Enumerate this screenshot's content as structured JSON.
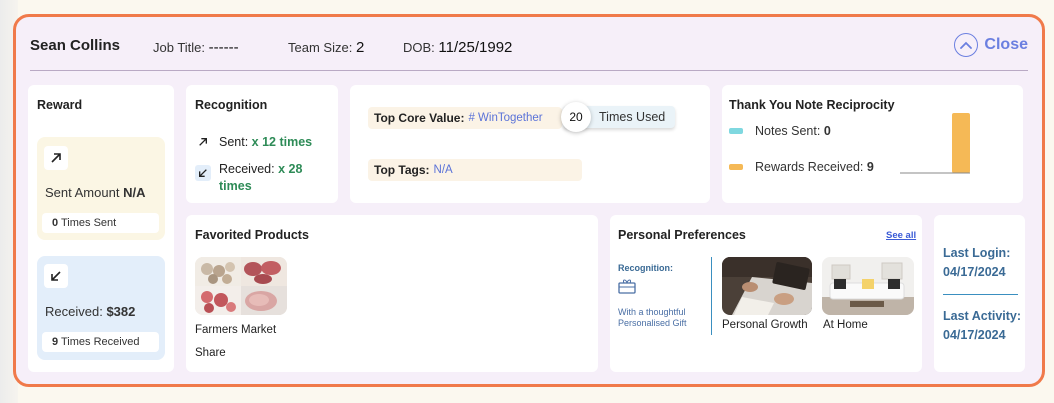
{
  "header": {
    "name": "Sean Collins",
    "job_title_label": "Job Title:",
    "job_title_value": "------",
    "team_size_label": "Team Size:",
    "team_size_value": "2",
    "dob_label": "DOB:",
    "dob_value": "11/25/1992",
    "close_label": "Close"
  },
  "reward": {
    "title": "Reward",
    "sent_label": "Sent Amount",
    "sent_value": "N/A",
    "times_sent_count": "0",
    "times_sent_label": "Times Sent",
    "received_label": "Received:",
    "received_value": "$382",
    "times_received_count": "9",
    "times_received_label": "Times Received"
  },
  "recognition": {
    "title": "Recognition",
    "sent_label": "Sent:",
    "sent_value": "x 12 times",
    "received_label": "Received:",
    "received_value_line1": "x 28",
    "received_value_line2": "times"
  },
  "core_value": {
    "label": "Top Core Value:",
    "value": "# WinTogether",
    "count": "20",
    "times_used_label": "Times Used",
    "top_tags_label": "Top Tags:",
    "top_tags_value": "N/A"
  },
  "reciprocity": {
    "title": "Thank You Note Reciprocity",
    "notes_sent_label": "Notes Sent:",
    "notes_sent_value": "0",
    "rewards_received_label": "Rewards Received:",
    "rewards_received_value": "9",
    "colors": {
      "notes": "#7fd8e0",
      "rewards": "#f5b956"
    }
  },
  "chart_data": {
    "type": "bar",
    "categories": [
      ""
    ],
    "series": [
      {
        "name": "Notes Sent",
        "values": [
          0
        ]
      },
      {
        "name": "Rewards Received",
        "values": [
          9
        ]
      }
    ],
    "title": "Thank You Note Reciprocity",
    "xlabel": "",
    "ylabel": "",
    "ylim": [
      0,
      9
    ]
  },
  "favorited": {
    "title": "Favorited Products",
    "product_name_line1": "Farmers Market",
    "product_name_line2": "Share"
  },
  "preferences": {
    "title": "Personal Preferences",
    "see_all": "See all",
    "recognition_label": "Recognition:",
    "recognition_desc_line1": "With a thoughtful",
    "recognition_desc_line2": "Personalised Gift",
    "items": [
      {
        "label": "Personal Growth"
      },
      {
        "label": "At Home"
      }
    ]
  },
  "activity": {
    "last_login_label": "Last Login:",
    "last_login_value": "04/17/2024",
    "last_activity_label": "Last Activity:",
    "last_activity_value": "04/17/2024"
  }
}
